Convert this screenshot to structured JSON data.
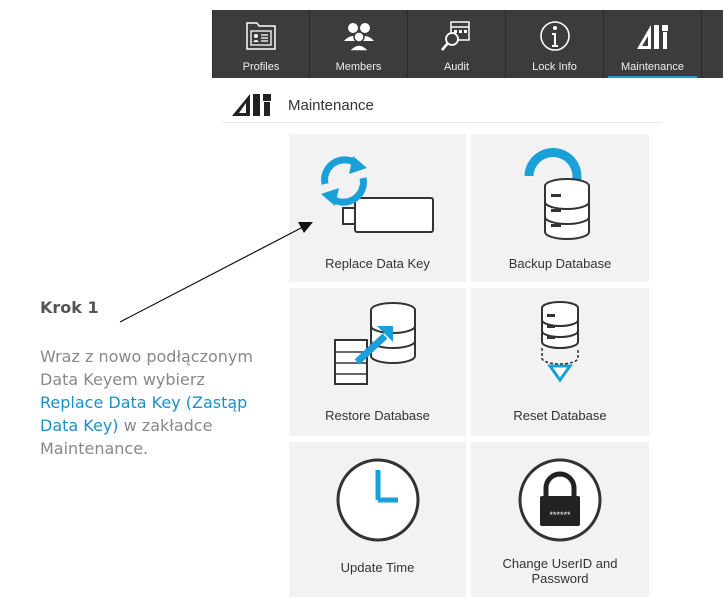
{
  "tabs": [
    {
      "label": "Profiles",
      "icon": "profile-card-icon"
    },
    {
      "label": "Members",
      "icon": "members-icon"
    },
    {
      "label": "Audit",
      "icon": "audit-icon"
    },
    {
      "label": "Lock Info",
      "icon": "info-icon"
    },
    {
      "label": "Maintenance",
      "icon": "maintenance-tools-icon",
      "active": true
    }
  ],
  "section": {
    "title": "Maintenance",
    "icon": "maintenance-tools-icon"
  },
  "tiles": [
    {
      "label": "Replace Data Key",
      "icon": "replace-data-key-icon"
    },
    {
      "label": "Backup Database",
      "icon": "backup-database-icon"
    },
    {
      "label": "Restore Database",
      "icon": "restore-database-icon"
    },
    {
      "label": "Reset Database",
      "icon": "reset-database-icon"
    },
    {
      "label": "Update Time",
      "icon": "clock-icon"
    },
    {
      "label_line1": "Change UserID and",
      "label_line2": "Password",
      "icon": "padlock-icon",
      "masked_text": "******"
    }
  ],
  "instruction": {
    "heading": "Krok 1",
    "text_part1": "Wraz z nowo podłączonym Data Keyem wybierz ",
    "highlight": "Replace Data Key (Zastąp Data Key)",
    "text_part2": " w zakładce Maintenance."
  },
  "colors": {
    "accent": "#1aa0d8",
    "tabbar_bg": "#3c3c3c",
    "tile_bg": "#f2f2f2",
    "highlight_text": "#1a90c8"
  }
}
